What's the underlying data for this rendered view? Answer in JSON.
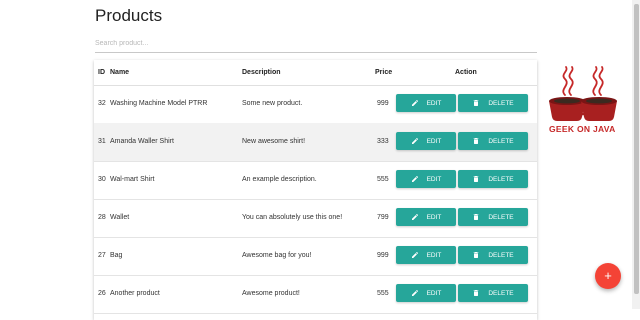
{
  "page": {
    "title": "Products"
  },
  "search": {
    "placeholder": "Search product..."
  },
  "table": {
    "columns": {
      "id": "ID",
      "name": "Name",
      "description": "Description",
      "price": "Price",
      "action": "Action"
    },
    "rows": [
      {
        "id": "32",
        "name": "Washing Machine Model PTRR",
        "description": "Some new product.",
        "price": "999"
      },
      {
        "id": "31",
        "name": "Amanda Waller Shirt",
        "description": "New awesome shirt!",
        "price": "333"
      },
      {
        "id": "30",
        "name": "Wal-mart Shirt",
        "description": "An example description.",
        "price": "555"
      },
      {
        "id": "28",
        "name": "Wallet",
        "description": "You can absolutely use this one!",
        "price": "799"
      },
      {
        "id": "27",
        "name": "Bag",
        "description": "Awesome bag for you!",
        "price": "999"
      },
      {
        "id": "26",
        "name": "Another product",
        "description": "Awesome product!",
        "price": "555"
      }
    ],
    "edit_label": "EDIT",
    "delete_label": "DELETE"
  },
  "branding": {
    "logo_text": "GEEK ON JAVA"
  },
  "fab": {
    "label": "+"
  },
  "colors": {
    "button": "#26a69a",
    "fab": "#f44336",
    "logo_red": "#c62828"
  },
  "icons": {
    "edit": "pencil-icon",
    "delete": "trash-icon",
    "fab": "plus-icon"
  }
}
